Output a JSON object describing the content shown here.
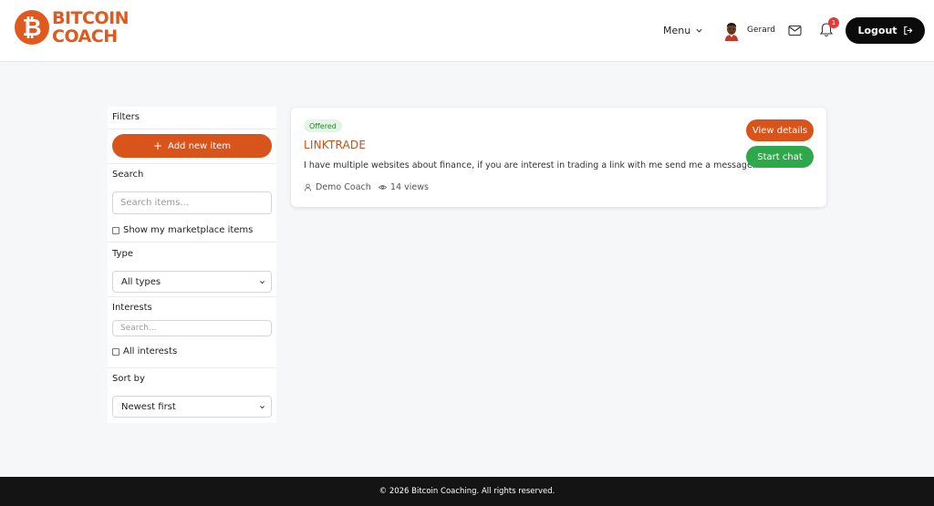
{
  "header": {
    "logo_symbol": "₿",
    "logo_line1": "BITCOIN",
    "logo_line2": "COACH",
    "menu_label": "Menu",
    "user_name": "Gerard",
    "notification_count": "1",
    "logout_label": "Logout"
  },
  "sidebar": {
    "filters_title": "Filters",
    "add_label": "Add new item",
    "search_title": "Search",
    "search_placeholder": "Search items...",
    "show_my_items_label": "Show my marketplace items",
    "type_title": "Type",
    "type_selected": "All types",
    "interests_title": "Interests",
    "interests_placeholder": "Search...",
    "all_interests_label": "All interests",
    "sort_title": "Sort by",
    "sort_selected": "Newest first"
  },
  "listing": {
    "badge": "Offered",
    "title": "LINKTRADE",
    "description": "I have multiple websites about finance, if you are interest in trading a link with me send me a message!",
    "author": "Demo Coach",
    "views": "14 views",
    "view_details_label": "View details",
    "start_chat_label": "Start chat"
  },
  "footer": {
    "text": "© 2026 Bitcoin Coaching. All rights reserved."
  },
  "colors": {
    "brand": "#df5a1c",
    "primary_button": "#d9541a",
    "success_button": "#2ea84a",
    "logout_button": "#0b0b0b",
    "footer_bg": "#141414"
  },
  "icons": {
    "logo": "bitcoin-icon",
    "menu": "chevron-down-icon",
    "mail": "mail-icon",
    "notifications": "bell-icon",
    "logout": "logout-icon",
    "add": "plus-icon",
    "author": "user-icon",
    "views": "eye-icon"
  }
}
